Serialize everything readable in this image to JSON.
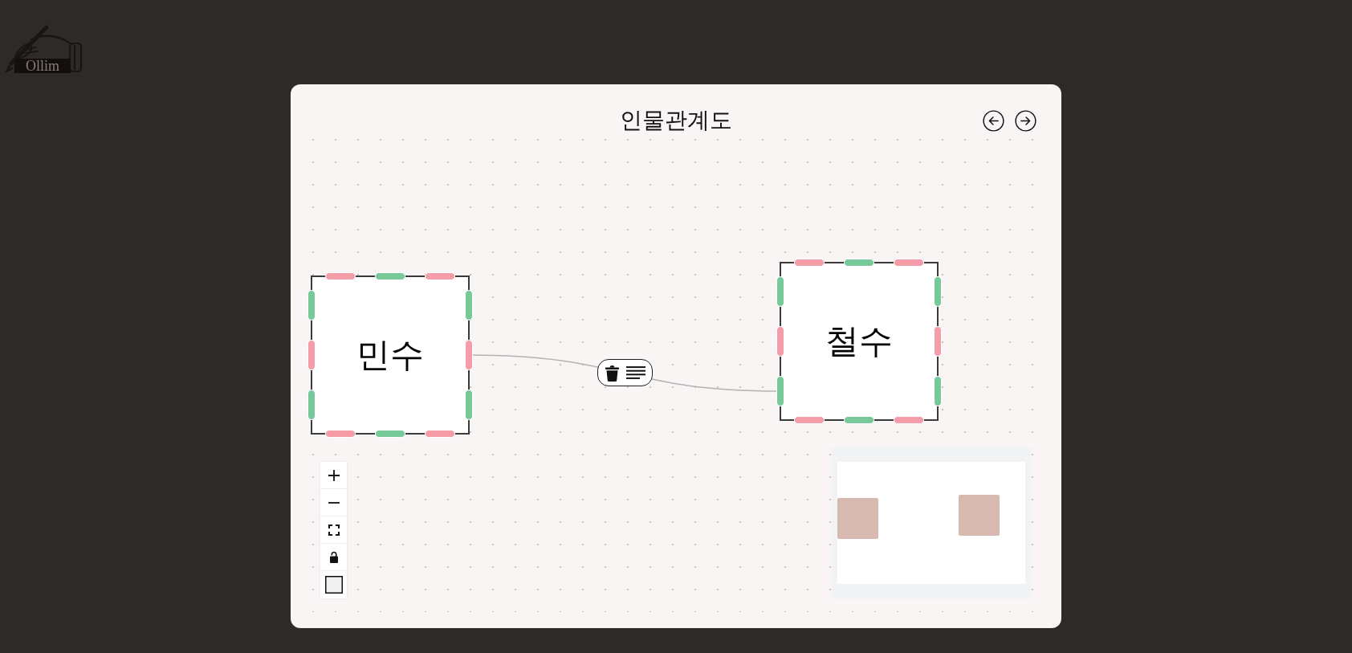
{
  "logo": {
    "text": "Ollim"
  },
  "header": {
    "title": "인물관계도",
    "nav_buttons": [
      {
        "kind": "back"
      },
      {
        "kind": "forward"
      }
    ]
  },
  "nodes": [
    {
      "label": "민수",
      "handles": {
        "top": [
          {
            "color": "#f59ca9"
          },
          {
            "color": "#77c999"
          },
          {
            "color": "#f59ca9"
          }
        ],
        "right": [
          {
            "color": "#77c999"
          },
          {
            "color": "#f59ca9"
          },
          {
            "color": "#77c999"
          }
        ],
        "bottom": [
          {
            "color": "#f59ca9"
          },
          {
            "color": "#77c999"
          },
          {
            "color": "#f59ca9"
          }
        ],
        "left": [
          {
            "color": "#77c999"
          },
          {
            "color": "#f59ca9"
          },
          {
            "color": "#77c999"
          }
        ]
      }
    },
    {
      "label": "철수",
      "handles": {
        "top": [
          {
            "color": "#f59ca9"
          },
          {
            "color": "#77c999"
          },
          {
            "color": "#f59ca9"
          }
        ],
        "right": [
          {
            "color": "#77c999"
          },
          {
            "color": "#f59ca9"
          },
          {
            "color": "#77c999"
          }
        ],
        "bottom": [
          {
            "color": "#f59ca9"
          },
          {
            "color": "#77c999"
          },
          {
            "color": "#f59ca9"
          }
        ],
        "left": [
          {
            "color": "#77c999"
          },
          {
            "color": "#f59ca9"
          },
          {
            "color": "#77c999"
          }
        ]
      }
    }
  ],
  "edges": [
    {
      "actions": [
        {
          "kind": "delete"
        },
        {
          "kind": "notes"
        }
      ]
    }
  ],
  "controls": [
    {
      "kind": "zoom_in"
    },
    {
      "kind": "zoom_out"
    },
    {
      "kind": "fit_view"
    },
    {
      "kind": "lock",
      "locked": false
    },
    {
      "kind": "toggle"
    }
  ],
  "minimap": {
    "shown": true
  }
}
